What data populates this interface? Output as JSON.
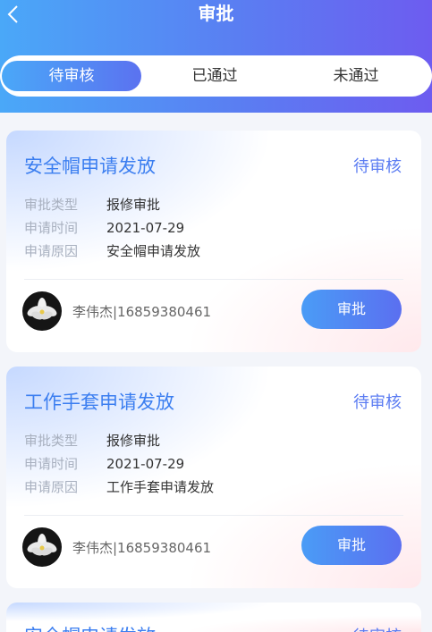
{
  "header": {
    "title": "审批"
  },
  "tabs": [
    {
      "label": "待审核",
      "active": true
    },
    {
      "label": "已通过",
      "active": false
    },
    {
      "label": "未通过",
      "active": false
    }
  ],
  "cards": [
    {
      "title": "安全帽申请发放",
      "status": "待审核",
      "fields": [
        {
          "label": "审批类型",
          "value": "报修审批"
        },
        {
          "label": "申请时间",
          "value": "2021-07-29"
        },
        {
          "label": "申请原因",
          "value": "安全帽申请发放"
        }
      ],
      "applicant": "李伟杰|16859380461",
      "button": "审批"
    },
    {
      "title": "工作手套申请发放",
      "status": "待审核",
      "fields": [
        {
          "label": "审批类型",
          "value": "报修审批"
        },
        {
          "label": "申请时间",
          "value": "2021-07-29"
        },
        {
          "label": "申请原因",
          "value": "工作手套申请发放"
        }
      ],
      "applicant": "李伟杰|16859380461",
      "button": "审批"
    },
    {
      "title": "安全帽申请发放",
      "status": "待审核"
    }
  ],
  "colors": {
    "accent": "#3b7ef0",
    "header_start": "#4aa8f8",
    "header_end": "#6d5cf0"
  }
}
